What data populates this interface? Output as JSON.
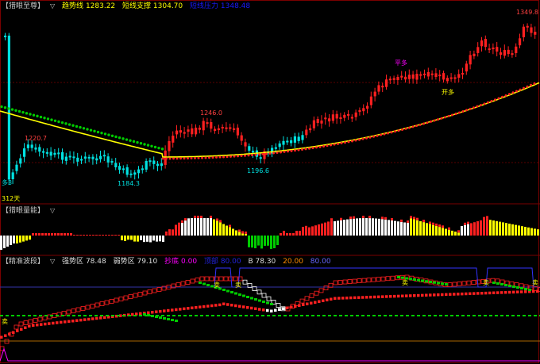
{
  "colors": {
    "bg": "#000000",
    "up": "#ff2020",
    "down": "#00e0e0",
    "frame": "#7a0000",
    "yellow": "#ffff00",
    "green": "#00cc00",
    "white": "#ffffff",
    "cyan": "#00ffff",
    "magenta": "#ff00ff",
    "blue": "#0000cc",
    "orange": "#ff8c00"
  },
  "panel1": {
    "name": "【猎眼至尊】",
    "items": [
      {
        "label": "趋势线",
        "value": "1283.22",
        "color": "#ffff00"
      },
      {
        "label": "短线支撑",
        "value": "1304.70",
        "color": "#ffff00"
      },
      {
        "label": "短线压力",
        "value": "1348.48",
        "color": "#0000ff"
      }
    ],
    "annotations": {
      "high": "1349.8",
      "p1246": "1246.0",
      "p1220": "1220.7",
      "p1184": "1184.3",
      "p1196": "1196.6",
      "ping_duo": "平多",
      "kai_duo": "开多",
      "left_marker": "多3",
      "days": "312天"
    }
  },
  "panel2": {
    "name": "【猎眼量能】"
  },
  "panel3": {
    "name": "【精准波段】",
    "items": [
      {
        "label": "强势区",
        "value": "78.48",
        "color": "#dddddd"
      },
      {
        "label": "弱势区",
        "value": "79.10",
        "color": "#dddddd"
      },
      {
        "label": "抄底",
        "value": "0.00",
        "color": "#ff00ff"
      },
      {
        "label": "顶部",
        "value": "80.00",
        "color": "#0000cc"
      },
      {
        "label": "B",
        "value": "78.30",
        "color": "#dddddd"
      },
      {
        "label": "",
        "value": "20.00",
        "color": "#ff8c00"
      },
      {
        "label": "",
        "value": "80.00",
        "color": "#6666ff"
      }
    ],
    "marker": "卖"
  }
}
